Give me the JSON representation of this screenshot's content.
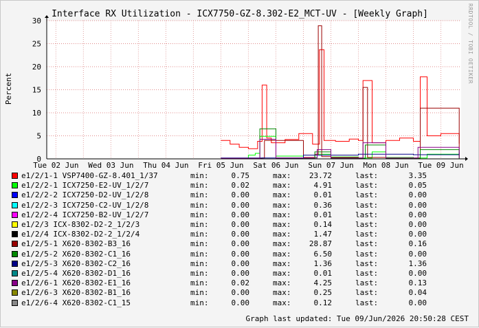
{
  "chart_data": {
    "type": "line",
    "title": "Interface RX Utilization - ICX7750-GZ-8.302-E2_MCT-UV - [Weekly Graph]",
    "ylabel": "Percent",
    "xlabel": "",
    "ylim": [
      0,
      30
    ],
    "yticks": [
      0,
      5,
      10,
      15,
      20,
      25,
      30
    ],
    "xlim": [
      "2026-06-02T08:00",
      "2026-06-09T20:50"
    ],
    "xtick_labels": [
      "Tue 02 Jun",
      "Wed 03 Jun",
      "Thu 04 Jun",
      "Fri 05 Jun",
      "Sat 06 Jun",
      "Sun 07 Jun",
      "Mon 08 Jun",
      "Tue 09 Jun"
    ],
    "grid": true,
    "legend_position": "below",
    "series": [
      {
        "name": "e1/2/1-1 VSP7400-GZ-8.401_1/37",
        "color": "#ff0000",
        "stats": {
          "min": "0.75",
          "max": "23.72",
          "last": "3.35"
        },
        "x": [
          "2026-06-05T12:00",
          "2026-06-05T16:00",
          "2026-06-05T20:00",
          "2026-06-06T00:00",
          "2026-06-06T04:00",
          "2026-06-06T06:00",
          "2026-06-06T08:00",
          "2026-06-06T10:00",
          "2026-06-06T16:00",
          "2026-06-06T22:00",
          "2026-06-07T04:00",
          "2026-06-07T07:00",
          "2026-06-07T09:00",
          "2026-06-07T14:00",
          "2026-06-07T20:00",
          "2026-06-08T00:00",
          "2026-06-08T02:00",
          "2026-06-08T06:00",
          "2026-06-08T12:00",
          "2026-06-08T18:00",
          "2026-06-09T00:00",
          "2026-06-09T03:00",
          "2026-06-09T06:00",
          "2026-06-09T12:00",
          "2026-06-09T20:00"
        ],
        "y": [
          4.0,
          3.2,
          2.5,
          2.2,
          3.8,
          16.0,
          4.5,
          3.5,
          4.2,
          5.5,
          3.2,
          23.7,
          4.0,
          3.8,
          4.3,
          4.0,
          17.0,
          3.5,
          4.0,
          4.5,
          3.8,
          17.8,
          5.0,
          5.5,
          3.3
        ]
      },
      {
        "name": "e1/2/2-1 ICX7250-E2-UV_1/2/7",
        "color": "#00ff00",
        "stats": {
          "min": "0.02",
          "max": "4.91",
          "last": "0.05"
        },
        "x": [
          "2026-06-05T12:00",
          "2026-06-06T00:00",
          "2026-06-06T03:00",
          "2026-06-06T05:00",
          "2026-06-06T12:00",
          "2026-06-07T00:00",
          "2026-06-07T06:00",
          "2026-06-07T12:00",
          "2026-06-08T00:00",
          "2026-06-08T06:00",
          "2026-06-08T12:00",
          "2026-06-09T00:00",
          "2026-06-09T06:00",
          "2026-06-09T20:00"
        ],
        "y": [
          0.05,
          0.8,
          1.2,
          4.9,
          0.6,
          0.3,
          1.0,
          0.4,
          0.2,
          1.5,
          0.3,
          0.2,
          1.0,
          0.05
        ]
      },
      {
        "name": "e1/2/2-2 ICX7250-D2-UV_1/2/8",
        "color": "#0000ff",
        "stats": {
          "min": "0.00",
          "max": "0.01",
          "last": "0.00"
        },
        "x": [
          "2026-06-02T08:00",
          "2026-06-09T20:50"
        ],
        "y": [
          0.0,
          0.0
        ]
      },
      {
        "name": "e1/2/2-3 ICX7250-C2-UV_1/2/8",
        "color": "#00ffff",
        "stats": {
          "min": "0.00",
          "max": "0.36",
          "last": "0.00"
        },
        "x": [
          "2026-06-02T08:00",
          "2026-06-09T20:50"
        ],
        "y": [
          0.0,
          0.0
        ]
      },
      {
        "name": "e1/2/2-4 ICX7250-B2-UV_1/2/7",
        "color": "#ff00ff",
        "stats": {
          "min": "0.00",
          "max": "0.01",
          "last": "0.00"
        },
        "x": [
          "2026-06-02T08:00",
          "2026-06-09T20:50"
        ],
        "y": [
          0.0,
          0.0
        ]
      },
      {
        "name": "e1/2/3 ICX-8302-D2-2_1/2/3",
        "color": "#ffff00",
        "stats": {
          "min": "0.00",
          "max": "0.14",
          "last": "0.00"
        },
        "x": [
          "2026-06-02T08:00",
          "2026-06-09T20:50"
        ],
        "y": [
          0.0,
          0.0
        ]
      },
      {
        "name": "e1/2/4 ICX-8302-D2-2_1/2/4",
        "color": "#000000",
        "stats": {
          "min": "0.00",
          "max": "1.47",
          "last": "0.00"
        },
        "x": [
          "2026-06-02T08:00",
          "2026-06-09T20:50"
        ],
        "y": [
          0.0,
          0.0
        ]
      },
      {
        "name": "e1/2/5-1 X620-8302-B3_16",
        "color": "#990000",
        "stats": {
          "min": "0.00",
          "max": "28.87",
          "last": "0.16"
        },
        "x": [
          "2026-06-05T12:00",
          "2026-06-06T06:00",
          "2026-06-06T07:00",
          "2026-06-07T00:00",
          "2026-06-07T05:00",
          "2026-06-07T06:30",
          "2026-06-07T08:00",
          "2026-06-07T12:00",
          "2026-06-08T00:00",
          "2026-06-08T02:00",
          "2026-06-08T04:00",
          "2026-06-08T12:00",
          "2026-06-09T00:00",
          "2026-06-09T03:00",
          "2026-06-09T20:00"
        ],
        "y": [
          0.1,
          0.2,
          4.0,
          0.3,
          1.0,
          28.9,
          0.5,
          0.3,
          0.2,
          15.5,
          0.3,
          0.2,
          0.2,
          11.0,
          0.16
        ]
      },
      {
        "name": "e1/2/5-2 X620-8302-C1_16",
        "color": "#008800",
        "stats": {
          "min": "0.00",
          "max": "6.50",
          "last": "0.00"
        },
        "x": [
          "2026-06-05T12:00",
          "2026-06-06T05:00",
          "2026-06-06T12:00",
          "2026-06-07T05:00",
          "2026-06-07T12:00",
          "2026-06-08T03:00",
          "2026-06-08T12:00",
          "2026-06-09T03:00",
          "2026-06-09T20:00"
        ],
        "y": [
          0.0,
          6.5,
          0.1,
          1.5,
          0.1,
          3.0,
          0.1,
          2.0,
          0.0
        ]
      },
      {
        "name": "e1/2/5-3 X620-8302-C2_16",
        "color": "#000088",
        "stats": {
          "min": "0.00",
          "max": "1.36",
          "last": "1.36"
        },
        "x": [
          "2026-06-05T12:00",
          "2026-06-07T00:00",
          "2026-06-08T00:00",
          "2026-06-09T00:00",
          "2026-06-09T20:00"
        ],
        "y": [
          0.2,
          0.8,
          1.0,
          0.9,
          1.36
        ]
      },
      {
        "name": "e1/2/5-4 X620-8302-D1_16",
        "color": "#008888",
        "stats": {
          "min": "0.00",
          "max": "0.01",
          "last": "0.00"
        },
        "x": [
          "2026-06-02T08:00",
          "2026-06-09T20:50"
        ],
        "y": [
          0.0,
          0.0
        ]
      },
      {
        "name": "e1/2/6-1 X620-8302-E1_16",
        "color": "#880088",
        "stats": {
          "min": "0.02",
          "max": "4.25",
          "last": "0.13"
        },
        "x": [
          "2026-06-05T12:00",
          "2026-06-06T05:00",
          "2026-06-06T12:00",
          "2026-06-07T06:00",
          "2026-06-07T12:00",
          "2026-06-08T02:00",
          "2026-06-08T12:00",
          "2026-06-09T02:00",
          "2026-06-09T20:00"
        ],
        "y": [
          0.1,
          4.25,
          0.2,
          2.0,
          0.2,
          3.5,
          0.2,
          2.5,
          0.13
        ]
      },
      {
        "name": "e1/2/6-3 X620-8302-B1_16",
        "color": "#888800",
        "stats": {
          "min": "0.00",
          "max": "0.25",
          "last": "0.04"
        },
        "x": [
          "2026-06-02T08:00",
          "2026-06-09T20:50"
        ],
        "y": [
          0.0,
          0.04
        ]
      },
      {
        "name": "e1/2/6-4 X620-8302-C1_15",
        "color": "#888888",
        "stats": {
          "min": "0.00",
          "max": "0.12",
          "last": "0.00"
        },
        "x": [
          "2026-06-02T08:00",
          "2026-06-09T20:50"
        ],
        "y": [
          0.0,
          0.0
        ]
      }
    ]
  },
  "labels": {
    "min": "min:",
    "max": "max:",
    "last": "last:"
  },
  "footer": "Graph last updated: Tue 09/Jun/2026 20:50:28 CEST",
  "side_label": "RRDTOOL / TOBI OETIKER"
}
